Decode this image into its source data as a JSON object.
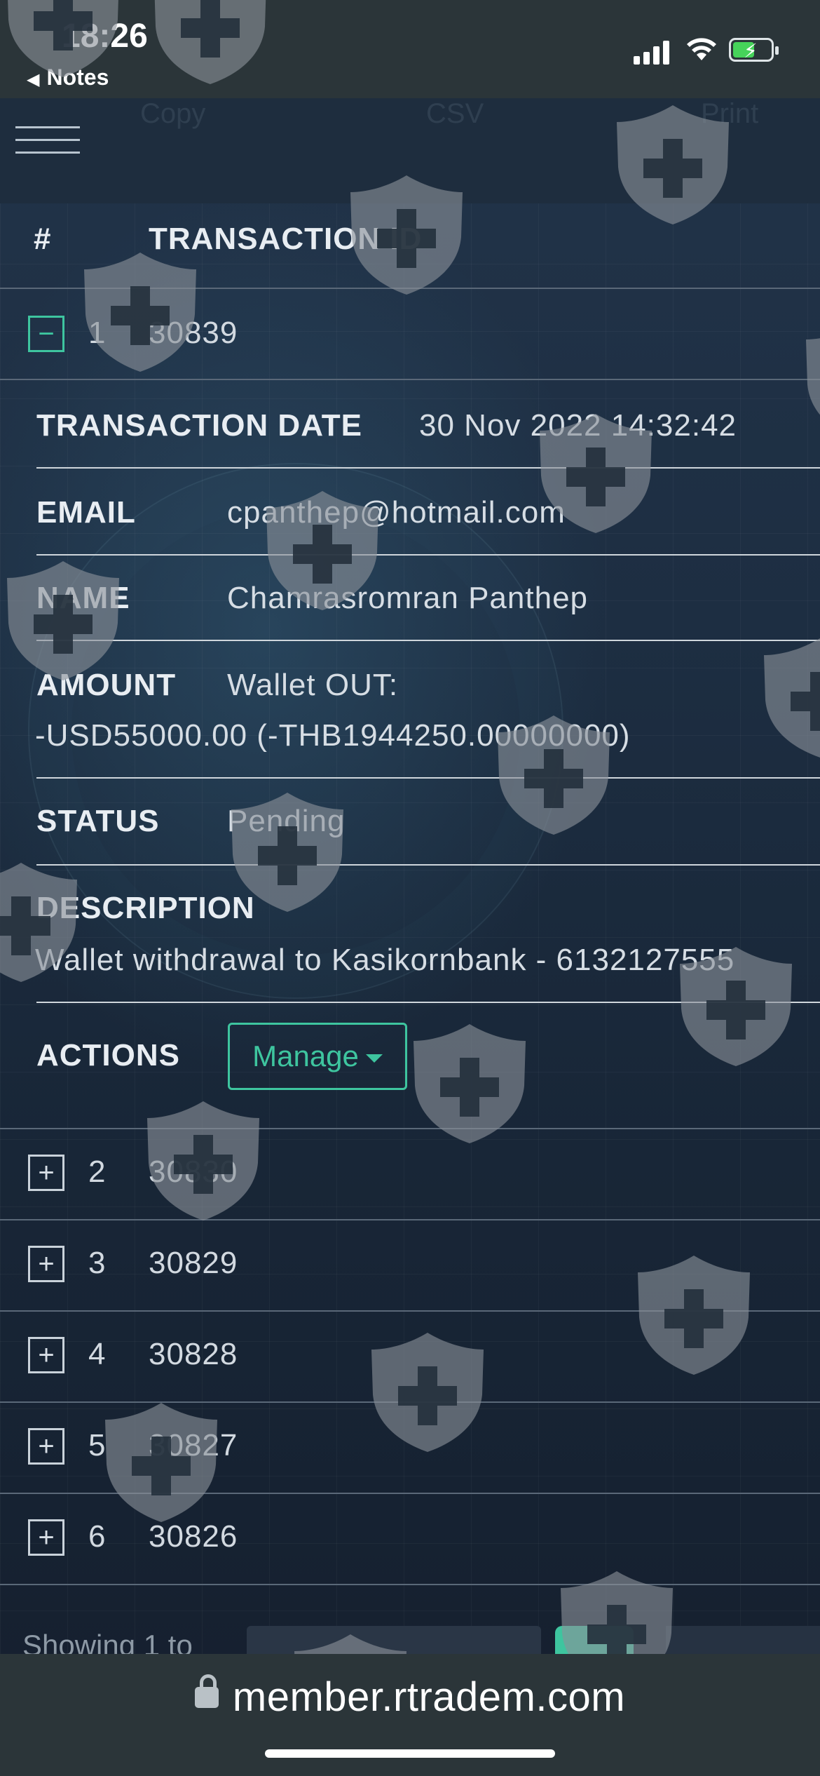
{
  "status_bar": {
    "time": "18:26",
    "back_label": "Notes",
    "icons": [
      "signal-icon",
      "wifi-icon",
      "battery-charging-icon"
    ]
  },
  "toolbar": {
    "menu_icon": "hamburger-icon",
    "copy_label": "Copy",
    "csv_label": "CSV",
    "print_label": "Print"
  },
  "table": {
    "headers": [
      "#",
      "TRANSACTION ID"
    ],
    "expanded_row": {
      "num": "1",
      "id": "30839",
      "toggle": "−"
    },
    "details": {
      "date_label": "TRANSACTION DATE",
      "date_value": "30 Nov 2022 14:32:42",
      "email_label": "EMAIL",
      "email_value": "cpanthep@hotmail.com",
      "name_label": "NAME",
      "name_value": "Chamrasromran Panthep",
      "amount_label": "AMOUNT",
      "amount_value_1": "Wallet OUT:",
      "amount_value_2": "-USD55000.00 (-THB1944250.00000000)",
      "status_label": "STATUS",
      "status_value": "Pending",
      "description_label": "DESCRIPTION",
      "description_value": "Wallet withdrawal to Kasikornbank - 6132127555",
      "actions_label": "ACTIONS",
      "manage_label": "Manage"
    },
    "rows": [
      {
        "num": "2",
        "id": "30830"
      },
      {
        "num": "3",
        "id": "30829"
      },
      {
        "num": "4",
        "id": "30828"
      },
      {
        "num": "5",
        "id": "30827"
      },
      {
        "num": "6",
        "id": "30826"
      }
    ],
    "collapsed_toggle": "+"
  },
  "footer": {
    "showing_text": "Showing 1 to"
  },
  "browser": {
    "url": "member.rtradem.com"
  },
  "colors": {
    "accent": "#3ec59f",
    "background": "#1c2a3a",
    "watermark": "#8a929a"
  }
}
